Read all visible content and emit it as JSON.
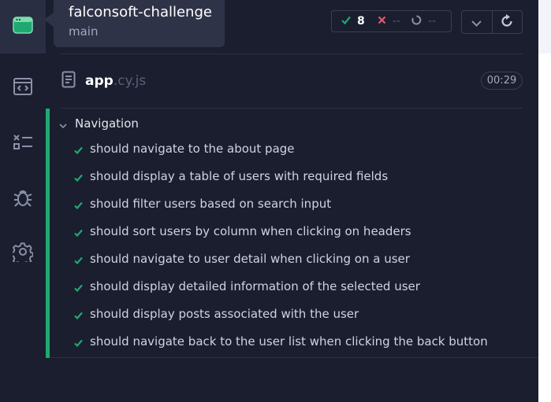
{
  "sidebar": {
    "items": [
      {
        "icon": "specs-icon",
        "active": true
      },
      {
        "icon": "runs-icon"
      },
      {
        "icon": "test-list-icon"
      },
      {
        "icon": "debug-bug-icon"
      },
      {
        "icon": "settings-gear-icon"
      }
    ]
  },
  "project": {
    "name": "falconsoft-challenge",
    "branch": "main"
  },
  "stats": {
    "passed": "8",
    "failed": "--",
    "pending": "--"
  },
  "spec": {
    "name": "app",
    "ext": ".cy.js",
    "duration": "00:29"
  },
  "suite": {
    "title": "Navigation",
    "tests": [
      "should navigate to the about page",
      "should display a table of users with required fields",
      "should filter users based on search input",
      "should sort users by column when clicking on headers",
      "should navigate to user detail when clicking on a user",
      "should display detailed information of the selected user",
      "should display posts associated with the user",
      "should navigate back to the user list when clicking the back button"
    ]
  },
  "colors": {
    "pass": "#1fa971",
    "fail": "#e45770",
    "pending": "#555a72",
    "background": "#1b1e2e",
    "surface": "#2f3347"
  }
}
